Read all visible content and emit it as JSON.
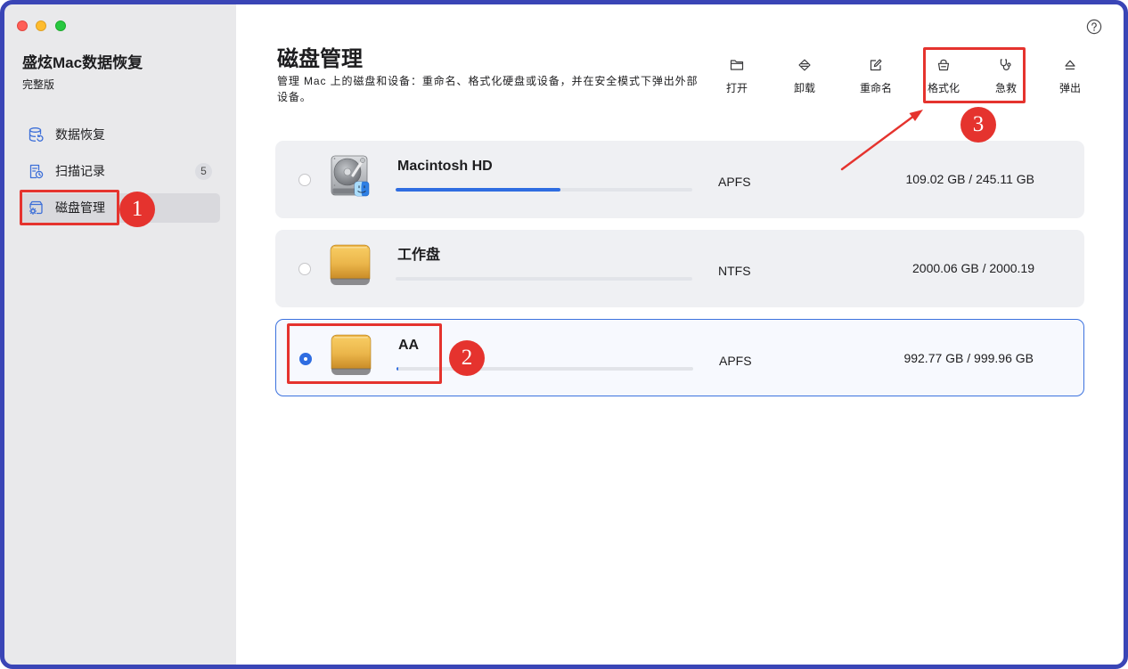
{
  "app": {
    "name": "盛炫Mac数据恢复",
    "edition": "完整版"
  },
  "sidebar": {
    "items": [
      {
        "label": "数据恢复",
        "icon": "database-icon",
        "badge": null,
        "selected": false
      },
      {
        "label": "扫描记录",
        "icon": "scan-history-icon",
        "badge": "5",
        "selected": false
      },
      {
        "label": "磁盘管理",
        "icon": "disk-management-icon",
        "badge": null,
        "selected": true
      }
    ]
  },
  "header": {
    "title": "磁盘管理",
    "subtitle": "管理 Mac 上的磁盘和设备：重命名、格式化硬盘或设备，并在安全模式下弹出外部设备。",
    "help_icon": "help-icon"
  },
  "toolbar": {
    "items": [
      {
        "label": "打开",
        "icon": "folder-open-icon"
      },
      {
        "label": "卸载",
        "icon": "unmount-icon"
      },
      {
        "label": "重命名",
        "icon": "rename-icon"
      },
      {
        "label": "格式化",
        "icon": "format-icon"
      },
      {
        "label": "急救",
        "icon": "first-aid-icon"
      },
      {
        "label": "弹出",
        "icon": "eject-icon"
      }
    ]
  },
  "disks": [
    {
      "name": "Macintosh HD",
      "fs": "APFS",
      "size": "109.02 GB / 245.11 GB",
      "used_fraction": 0.555,
      "icon": "internal-hard-disk-icon",
      "selected": false
    },
    {
      "name": "工作盘",
      "fs": "NTFS",
      "size": "2000.06 GB / 2000.19",
      "used_fraction": 0.0,
      "icon": "external-drive-icon",
      "selected": false
    },
    {
      "name": "AA",
      "fs": "APFS",
      "size": "992.77 GB / 999.96 GB",
      "used_fraction": 0.007,
      "icon": "external-drive-icon",
      "selected": true
    }
  ],
  "annotations": {
    "markers": [
      "1",
      "2",
      "3"
    ]
  },
  "colors": {
    "accent": "#2f6de1",
    "annotation_red": "#e5332e",
    "window_frame": "#3a45b6",
    "sidebar_bg": "#e9e9eb",
    "row_bg": "#eff0f3"
  }
}
